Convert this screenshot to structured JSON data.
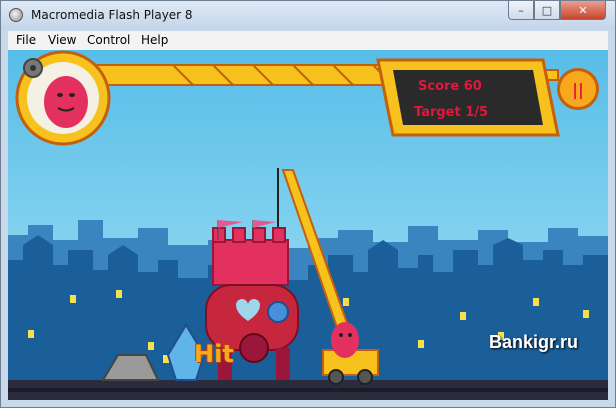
{
  "window": {
    "title": "Macromedia Flash Player 8",
    "minimize_glyph": "–",
    "maximize_glyph": "□",
    "close_glyph": "✕"
  },
  "menu": {
    "items": [
      "File",
      "View",
      "Control",
      "Help"
    ]
  },
  "hud": {
    "score_text": "Score  60",
    "target_text": "Target  1/5",
    "pause_glyph": "||"
  },
  "game": {
    "hit_text": "Hit"
  },
  "watermark": "Bankigr.ru",
  "colors": {
    "hud_text": "#e2173c",
    "crane_yellow": "#f7c21d",
    "sky": "#57bde8",
    "city": "#1a5f99"
  }
}
